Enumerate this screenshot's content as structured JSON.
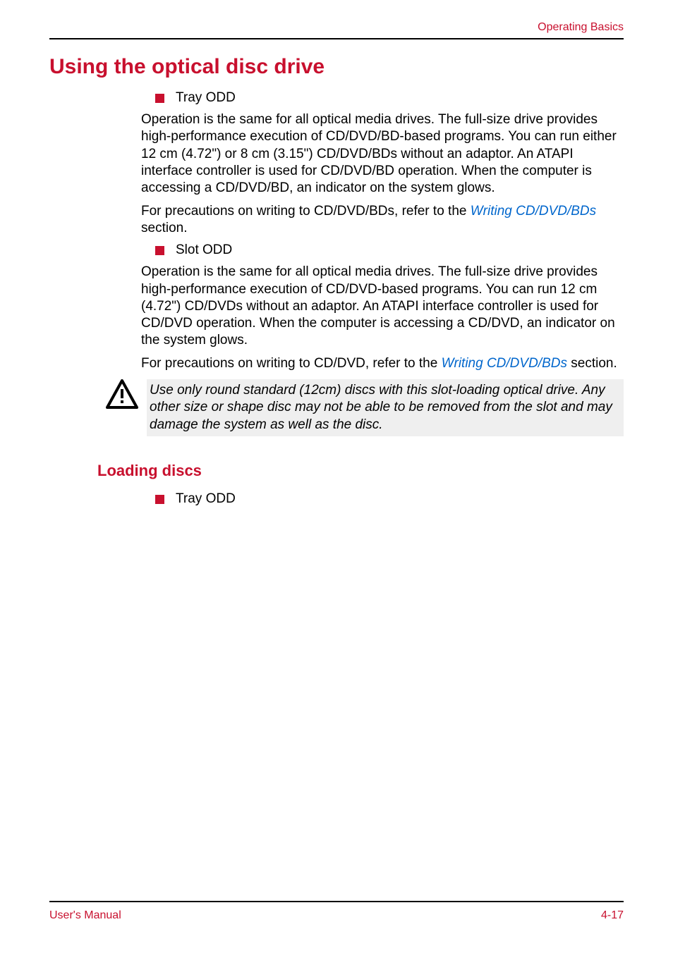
{
  "header": {
    "title": "Operating Basics"
  },
  "main": {
    "section_title": "Using the optical disc drive",
    "bullet1": "Tray ODD",
    "para1": "Operation is the same for all optical media drives. The full-size drive provides high-performance execution of CD/DVD/BD-based programs. You can run either 12 cm (4.72\") or 8 cm (3.15\") CD/DVD/BDs without an adaptor. An ATAPI interface controller is used for CD/DVD/BD operation. When the computer is accessing a CD/DVD/BD, an indicator on the system glows.",
    "para2_pre": "For precautions on writing to CD/DVD/BDs, refer to the ",
    "para2_link": "Writing CD/DVD/BDs",
    "para2_post": " section.",
    "bullet2": "Slot ODD",
    "para3": "Operation is the same for all optical media drives. The full-size drive provides high-performance execution of CD/DVD-based programs. You can run 12 cm (4.72\") CD/DVDs without an adaptor. An ATAPI interface controller is used for CD/DVD operation. When the computer is accessing a CD/DVD, an indicator on the system glows.",
    "para4_pre": "For precautions on writing to CD/DVD, refer to the ",
    "para4_link": "Writing CD/DVD/BDs",
    "para4_post": " section.",
    "note_text": "Use only round standard (12cm) discs with this slot-loading optical drive. Any other size or shape disc may not be able to be removed from the slot and may damage the system as well as the disc.",
    "subsection_title": "Loading discs",
    "bullet3": "Tray ODD"
  },
  "footer": {
    "left": "User's Manual",
    "right": "4-17"
  }
}
